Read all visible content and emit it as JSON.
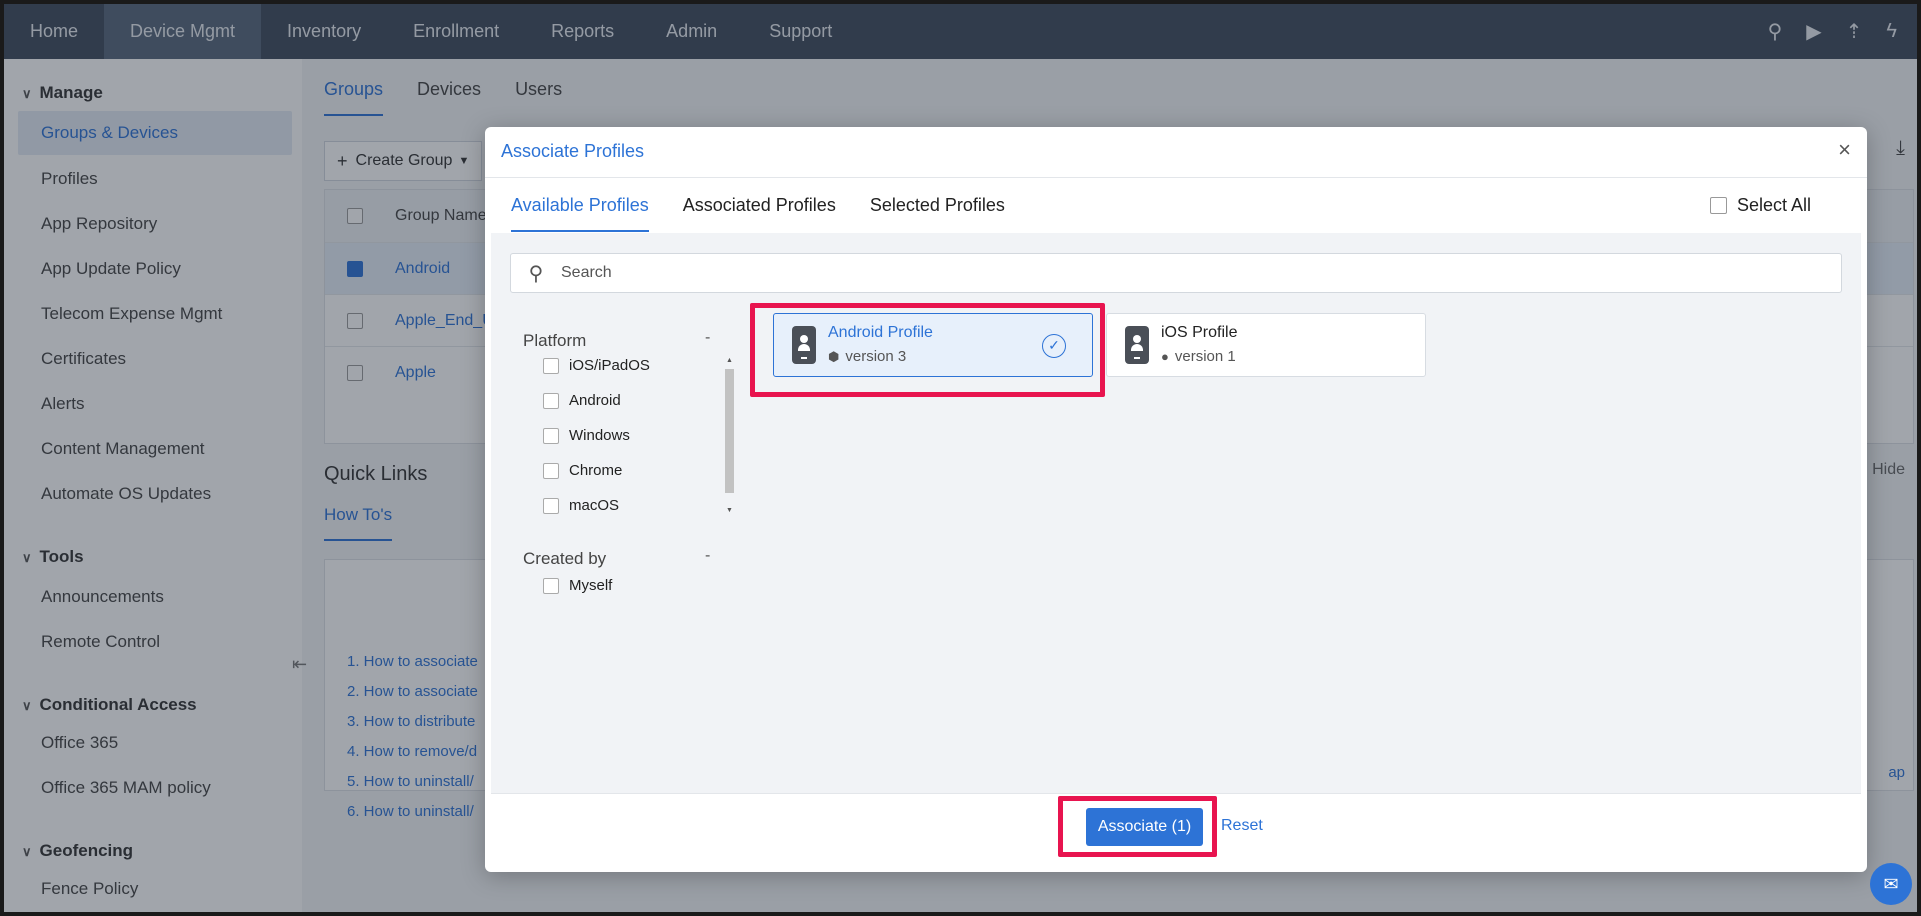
{
  "topnav": {
    "items": [
      "Home",
      "Device Mgmt",
      "Inventory",
      "Enrollment",
      "Reports",
      "Admin",
      "Support"
    ],
    "active_index": 1,
    "icons": [
      "search-icon",
      "video-icon",
      "rocket-icon",
      "flash-icon"
    ]
  },
  "sidebar": {
    "sections": [
      {
        "label": "Manage",
        "items": [
          "Groups & Devices",
          "Profiles",
          "App Repository",
          "App Update Policy",
          "Telecom Expense Mgmt",
          "Certificates",
          "Alerts",
          "Content Management",
          "Automate OS Updates"
        ]
      },
      {
        "label": "Tools",
        "items": [
          "Announcements",
          "Remote Control"
        ]
      },
      {
        "label": "Conditional Access",
        "items": [
          "Office 365",
          "Office 365 MAM policy"
        ]
      },
      {
        "label": "Geofencing",
        "items": [
          "Fence Policy"
        ]
      }
    ],
    "active_item": "Groups & Devices"
  },
  "main": {
    "tabs": [
      "Groups",
      "Devices",
      "Users"
    ],
    "create_group": "Create Group",
    "grid": {
      "header": "Group Name",
      "rows": [
        {
          "name": "Android",
          "checked": true
        },
        {
          "name": "Apple_End_U",
          "checked": false
        },
        {
          "name": "Apple",
          "checked": false
        }
      ]
    },
    "quick_links": "Quick Links",
    "howtos_tab": "How To's",
    "howtos": [
      "1. How to associate",
      "2. How to associate",
      "3. How to distribute",
      "4. How to remove/d",
      "5. How to uninstall/",
      "6. How to uninstall/"
    ],
    "hide": "Hide",
    "map_link": "ap"
  },
  "modal": {
    "title": "Associate Profiles",
    "tabs": [
      "Available Profiles",
      "Associated Profiles",
      "Selected Profiles"
    ],
    "select_all": "Select All",
    "search_placeholder": "Search",
    "filters": {
      "platform_label": "Platform",
      "platform_options": [
        "iOS/iPadOS",
        "Android",
        "Windows",
        "Chrome",
        "macOS"
      ],
      "created_by_label": "Created by",
      "created_by_options": [
        "Myself"
      ],
      "collapse_symbol": "-"
    },
    "profiles": [
      {
        "name": "Android Profile",
        "version": "version 3",
        "os_icon": "android-icon",
        "selected": true
      },
      {
        "name": "iOS Profile",
        "version": "version 1",
        "os_icon": "apple-icon",
        "selected": false
      }
    ],
    "associate_button": "Associate (1)",
    "reset_link": "Reset"
  },
  "colors": {
    "accent": "#2d73d6",
    "nav_bg": "#3f4b5c",
    "highlight_annotation": "#e8144f"
  }
}
